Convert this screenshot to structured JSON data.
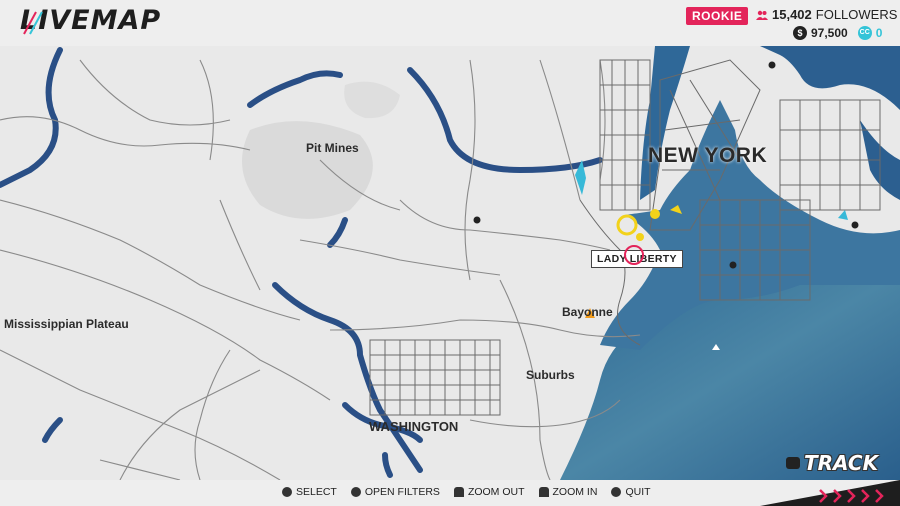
{
  "header": {
    "logo_text": "LIVEMAP",
    "rank": "ROOKIE",
    "followers_count": "15,402",
    "followers_label": "FOLLOWERS",
    "money": "97,500",
    "crew_credits": "0",
    "crew_credits_icon": "CC"
  },
  "map": {
    "labels": {
      "new_york": "NEW YORK",
      "pit_mines": "Pit Mines",
      "mississippian_plateau": "Mississippian Plateau",
      "bayonne": "Bayonne",
      "suburbs": "Suburbs",
      "washington": "WASHINGTON"
    },
    "poi_label": "LADY LIBERTY"
  },
  "track": {
    "label": "TRACK"
  },
  "controls": [
    {
      "icon": "cross-button-icon",
      "label": "SELECT"
    },
    {
      "icon": "circle-button-icon",
      "label": "OPEN FILTERS"
    },
    {
      "icon": "l2-button-icon",
      "label": "ZOOM OUT"
    },
    {
      "icon": "r2-button-icon",
      "label": "ZOOM IN"
    },
    {
      "icon": "circle-button-icon",
      "label": "QUIT"
    }
  ],
  "colors": {
    "accent": "#e3245a",
    "water": "#2e5a84",
    "crew_credits": "#35c4d8",
    "land": "#e9e9e9",
    "roads": "#5a5a5a"
  }
}
